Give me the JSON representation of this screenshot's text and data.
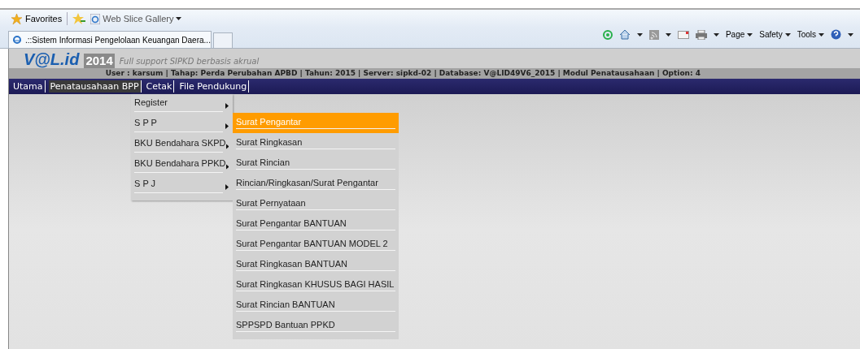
{
  "favorites_bar": {
    "favorites": "Favorites",
    "web_slice": "Web Slice Gallery"
  },
  "tab": {
    "title": ".::Sistem Informasi Pengelolaan Keuangan Daera..."
  },
  "command_bar": {
    "menus": [
      "Page",
      "Safety",
      "Tools"
    ]
  },
  "header": {
    "logo": "V@L.id",
    "logo_year": "2014",
    "tagline": "Full support SIPKD berbasis  akrual",
    "info": "User : karsum | Tahap: Perda Perubahan APBD | Tahun: 2015 | Server: sipkd-02 | Database: V@LID49V6_2015 | Modul Penatausahaan | Option: 4"
  },
  "menu_bar": [
    {
      "label": "Utama",
      "selected": false
    },
    {
      "label": "Penatausahaan BPP",
      "selected": true
    },
    {
      "label": "Cetak",
      "selected": false
    },
    {
      "label": "File Pendukung",
      "selected": false
    }
  ],
  "dropdown": [
    {
      "label": "Register"
    },
    {
      "label": "S P P"
    },
    {
      "label": "BKU Bendahara SKPD"
    },
    {
      "label": "BKU Bendahara PPKD"
    },
    {
      "label": "S P J"
    }
  ],
  "submenu": [
    {
      "label": "Surat Pengantar",
      "selected": true
    },
    {
      "label": "Surat Ringkasan",
      "selected": false
    },
    {
      "label": "Surat Rincian",
      "selected": false
    },
    {
      "label": "Rincian/Ringkasan/Surat Pengantar",
      "selected": false
    },
    {
      "label": "Surat Pernyataan",
      "selected": false
    },
    {
      "label": "Surat Pengantar BANTUAN",
      "selected": false
    },
    {
      "label": "Surat Pengantar BANTUAN MODEL 2",
      "selected": false
    },
    {
      "label": "Surat Ringkasan BANTUAN",
      "selected": false
    },
    {
      "label": "Surat Ringkasan KHUSUS BAGI HASIL",
      "selected": false
    },
    {
      "label": "Surat Rincian BANTUAN",
      "selected": false
    },
    {
      "label": "SPPSPD Bantuan PPKD",
      "selected": false
    }
  ]
}
